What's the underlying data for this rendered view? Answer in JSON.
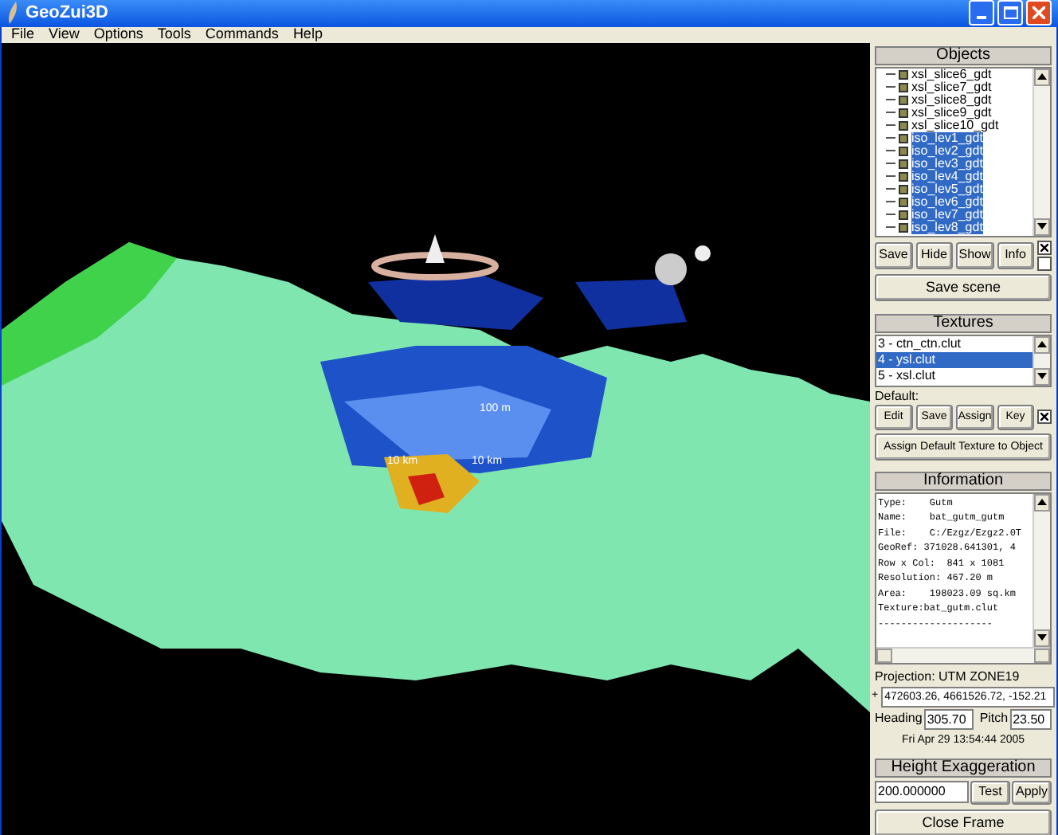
{
  "window": {
    "title": "GeoZui3D"
  },
  "menu": [
    "File",
    "View",
    "Options",
    "Tools",
    "Commands",
    "Help"
  ],
  "scene": {
    "labels": [
      "100 m",
      "10 km",
      "10 km"
    ]
  },
  "objects": {
    "title": "Objects",
    "items": [
      {
        "label": "xsl_slice6_gdt",
        "selected": false
      },
      {
        "label": "xsl_slice7_gdt",
        "selected": false
      },
      {
        "label": "xsl_slice8_gdt",
        "selected": false
      },
      {
        "label": "xsl_slice9_gdt",
        "selected": false
      },
      {
        "label": "xsl_slice10_gdt",
        "selected": false
      },
      {
        "label": "iso_lev1_gdt",
        "selected": true
      },
      {
        "label": "iso_lev2_gdt",
        "selected": true
      },
      {
        "label": "iso_lev3_gdt",
        "selected": true
      },
      {
        "label": "iso_lev4_gdt",
        "selected": true
      },
      {
        "label": "iso_lev5_gdt",
        "selected": true
      },
      {
        "label": "iso_lev6_gdt",
        "selected": true
      },
      {
        "label": "iso_lev7_gdt",
        "selected": true
      },
      {
        "label": "iso_lev8_gdt",
        "selected": true
      }
    ],
    "buttons": [
      "Save",
      "Hide",
      "Show",
      "Info"
    ],
    "save_scene": "Save scene"
  },
  "textures": {
    "title": "Textures",
    "items": [
      {
        "label": "3 - ctn_ctn.clut",
        "selected": false
      },
      {
        "label": "4 - ysl.clut",
        "selected": true
      },
      {
        "label": "5 - xsl.clut",
        "selected": false
      }
    ],
    "default_label": "Default:",
    "buttons": [
      "Edit",
      "Save",
      "Assign",
      "Key"
    ],
    "assign_button": "Assign Default Texture to Object"
  },
  "information": {
    "title": "Information",
    "lines": [
      "Type:    Gutm",
      "Name:    bat_gutm_gutm",
      "File:    C:/Ezgz/Ezgz2.0T",
      "GeoRef: 371028.641301, 4",
      "Row x Col:  841 x 1081",
      "Resolution: 467.20 m",
      "Area:    198023.09 sq.km",
      "Texture:bat_gutm.clut",
      "--------------------"
    ]
  },
  "projection": "Projection:  UTM ZONE19",
  "position": {
    "marker": "+",
    "value": "472603.26, 4661526.72, -152.21"
  },
  "heading": {
    "label": "Heading",
    "value": "305.70"
  },
  "pitch": {
    "label": "Pitch",
    "value": "23.50"
  },
  "date": "Fri Apr 29 13:54:44 2005",
  "height_exaggeration": {
    "title": "Height Exaggeration",
    "value": "200.000000",
    "buttons": [
      "Test",
      "Apply"
    ]
  },
  "close_button": "Close Frame"
}
